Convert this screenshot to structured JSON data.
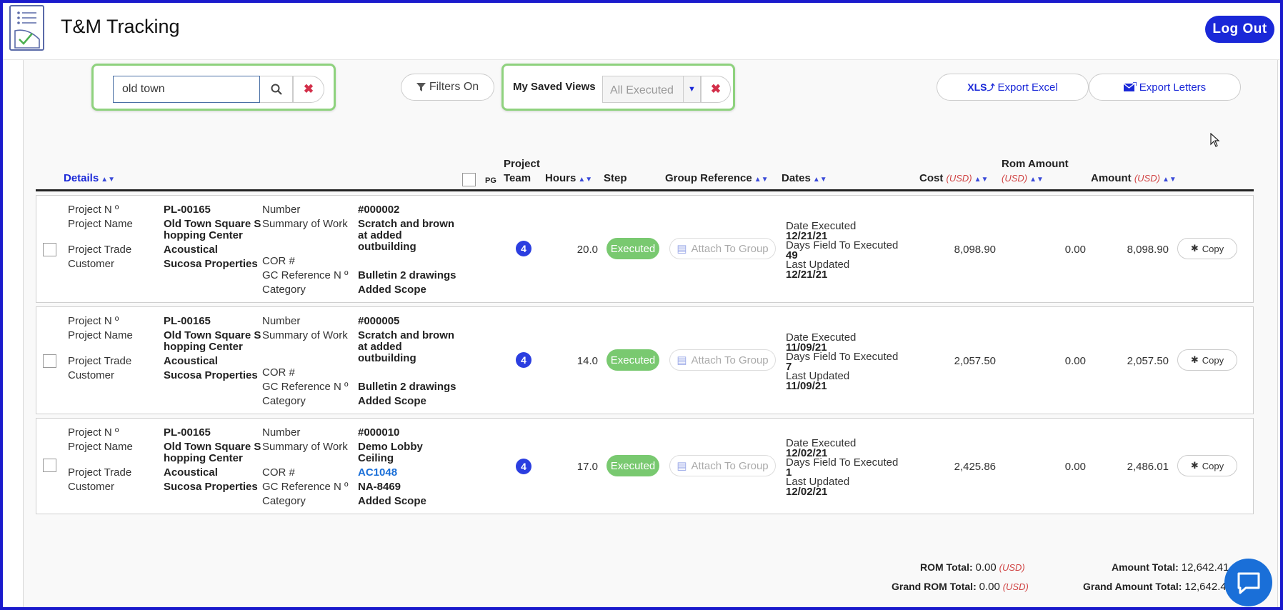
{
  "app": {
    "title": "T&M Tracking",
    "logout_label": "Log Out"
  },
  "toolbar": {
    "search_value": "old town",
    "filters_label": "Filters On",
    "saved_views_label": "My Saved Views",
    "saved_view_selected": "All Executed",
    "export_excel_prefix": "XLS",
    "export_excel_label": "Export Excel",
    "export_letters_label": "Export Letters"
  },
  "columns": {
    "details": "Details",
    "pg": "PG",
    "project": "Project",
    "team": "Team",
    "hours": "Hours",
    "step": "Step",
    "group_reference": "Group Reference",
    "dates": "Dates",
    "cost": "Cost",
    "rom_amount": "Rom Amount",
    "amount": "Amount",
    "usd": "(USD)"
  },
  "labels": {
    "project_no": "Project N º",
    "project_name": "Project Name",
    "project_trade": "Project Trade",
    "customer": "Customer",
    "number": "Number",
    "summary": "Summary of Work",
    "cor": "COR #",
    "gc_ref": "GC Reference N º",
    "category": "Category",
    "date_executed": "Date Executed",
    "days_field": "Days Field To Executed",
    "last_updated": "Last Updated",
    "attach": "Attach To Group",
    "copy": "Copy"
  },
  "rows": [
    {
      "project_no": "PL-00165",
      "project_name_1": "Old Town Square S",
      "project_name_2": "hopping Center",
      "trade": "Acoustical",
      "customer": "Sucosa Properties",
      "number": "#000002",
      "summary_1": "Scratch and brown",
      "summary_2": "at added",
      "summary_3": "outbuilding",
      "cor": "",
      "gc_ref": "Bulletin 2 drawings",
      "category": "Added Scope",
      "team": "4",
      "hours": "20.0",
      "step": "Executed",
      "date_executed": "12/21/21",
      "days": "49",
      "last_updated": "12/21/21",
      "cost": "8,098.90",
      "rom": "0.00",
      "amount": "8,098.90"
    },
    {
      "project_no": "PL-00165",
      "project_name_1": "Old Town Square S",
      "project_name_2": "hopping Center",
      "trade": "Acoustical",
      "customer": "Sucosa Properties",
      "number": "#000005",
      "summary_1": "Scratch and brown",
      "summary_2": "at added",
      "summary_3": "outbuilding",
      "cor": "",
      "gc_ref": "Bulletin 2 drawings",
      "category": "Added Scope",
      "team": "4",
      "hours": "14.0",
      "step": "Executed",
      "date_executed": "11/09/21",
      "days": "7",
      "last_updated": "11/09/21",
      "cost": "2,057.50",
      "rom": "0.00",
      "amount": "2,057.50"
    },
    {
      "project_no": "PL-00165",
      "project_name_1": "Old Town Square S",
      "project_name_2": "hopping Center",
      "trade": "Acoustical",
      "customer": "Sucosa Properties",
      "number": "#000010",
      "summary_1": "Demo Lobby",
      "summary_2": "Ceiling",
      "summary_3": "",
      "cor": "AC1048",
      "gc_ref": "NA-8469",
      "category": "Added Scope",
      "team": "4",
      "hours": "17.0",
      "step": "Executed",
      "date_executed": "12/02/21",
      "days": "1",
      "last_updated": "12/02/21",
      "cost": "2,425.86",
      "rom": "0.00",
      "amount": "2,486.01"
    }
  ],
  "totals": {
    "rom_total_label": "ROM Total:",
    "rom_total": "0.00",
    "grand_rom_label": "Grand ROM Total:",
    "grand_rom": "0.00",
    "amount_total_label": "Amount Total:",
    "amount_total": "12,642.41",
    "grand_amount_label": "Grand Amount Total:",
    "grand_amount": "12,642.41",
    "usd": "(USD)"
  },
  "colors": {
    "accent": "#1a28d8",
    "executed": "#79c970",
    "highlight": "#8fd27e",
    "usd_red": "#d04444"
  }
}
